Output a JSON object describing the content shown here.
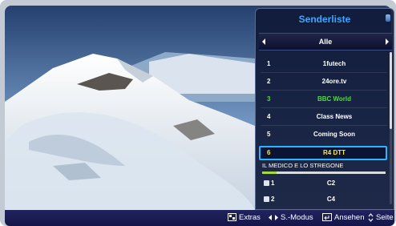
{
  "panel": {
    "title": "Senderliste",
    "filter": "Alle"
  },
  "channels": [
    {
      "number": "1",
      "name": "1futech"
    },
    {
      "number": "2",
      "name": "24ore.tv"
    },
    {
      "number": "3",
      "name": "BBC World"
    },
    {
      "number": "4",
      "name": "Class News"
    },
    {
      "number": "5",
      "name": "Coming Soon"
    }
  ],
  "selected": {
    "number": "6",
    "name": "R4 DTT"
  },
  "program": {
    "title": "IL MEDICO E LO STREGONE",
    "progress": 0.12
  },
  "analog": [
    {
      "number": "1",
      "name": "C2"
    },
    {
      "number": "2",
      "name": "C4"
    }
  ],
  "footer": {
    "extras": "Extras",
    "mode": "S.-Modus",
    "view": "Ansehen",
    "page": "Seite"
  },
  "colors": {
    "title": "#3fa6ff",
    "active_channel": "#56d64a",
    "selected_text": "#ffe84a",
    "selection_border": "#27b6ff",
    "progress": "#a8d83a"
  }
}
